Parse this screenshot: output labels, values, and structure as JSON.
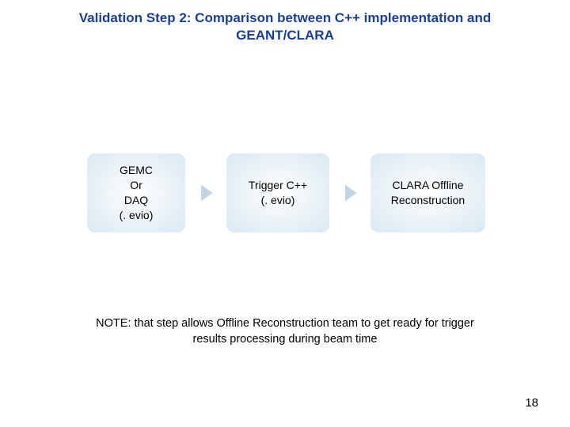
{
  "title": {
    "line1": "Validation Step 2: Comparison between C++ implementation and",
    "line2": "GEANT/CLARA"
  },
  "flow": {
    "box1": {
      "l1": "GEMC",
      "l2": "Or",
      "l3": "DAQ",
      "l4": "(. evio)"
    },
    "box2": {
      "l1": "Trigger C++",
      "l2": "(. evio)"
    },
    "box3": {
      "l1": "CLARA Offline",
      "l2": "Reconstruction"
    }
  },
  "note": {
    "line1": "NOTE: that step allows Offline Reconstruction team to get ready for trigger",
    "line2": "results processing during beam time"
  },
  "pagenum": "18"
}
